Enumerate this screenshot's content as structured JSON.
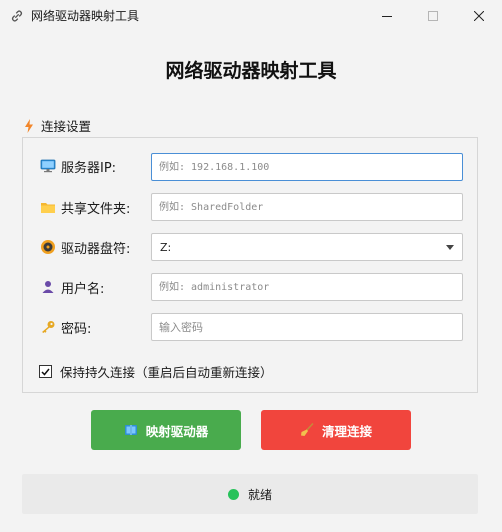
{
  "window": {
    "title": "网络驱动器映射工具"
  },
  "header": {
    "title": "网络驱动器映射工具"
  },
  "settings": {
    "section_title": "连接设置",
    "server": {
      "label": "服务器IP:",
      "placeholder": "例如: 192.168.1.100"
    },
    "share": {
      "label": "共享文件夹:",
      "placeholder": "例如: SharedFolder"
    },
    "drive": {
      "label": "驱动器盘符:",
      "value": "Z:"
    },
    "username": {
      "label": "用户名:",
      "placeholder": "例如: administrator"
    },
    "password": {
      "label": "密码:",
      "placeholder": "输入密码"
    },
    "persistent": {
      "label": "保持持久连接（重启后自动重新连接）",
      "checked": true
    }
  },
  "actions": {
    "map_label": "映射驱动器",
    "clear_label": "清理连接"
  },
  "status": {
    "text": "就绪",
    "color": "#27c25a"
  },
  "colors": {
    "map_button": "#49ab4d",
    "clear_button": "#f1453d",
    "focus_border": "#4a8fd6"
  }
}
